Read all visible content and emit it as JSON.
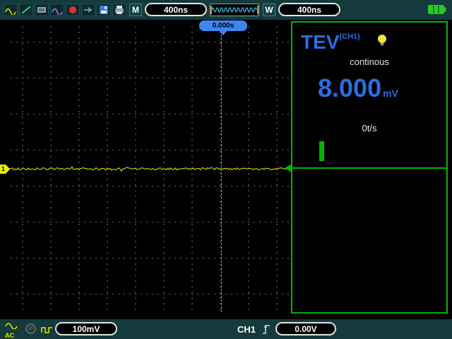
{
  "colors": {
    "accent_blue": "#2e6be0",
    "trace_yellow": "#f2ef00",
    "panel_green": "#00b400",
    "bar_bg": "#143a3c",
    "cursor_blue": "#3f86ee"
  },
  "toolbar": {
    "m_label": "M",
    "m_timebase": "400ns",
    "w_label": "W",
    "w_timebase": "400ns"
  },
  "cursor": {
    "time_label": "0.000s"
  },
  "measure_panel": {
    "title": "TEV",
    "channel": "(CH1)",
    "mode": "continous",
    "value": "8.000",
    "unit": "mV",
    "rate": "0t/s"
  },
  "channel_marker": {
    "label": "1"
  },
  "bottom_bar": {
    "coupling": "AC",
    "bw_limit": "20",
    "volts_div": "100mV",
    "trigger_channel": "CH1",
    "trigger_level": "0.00V"
  }
}
